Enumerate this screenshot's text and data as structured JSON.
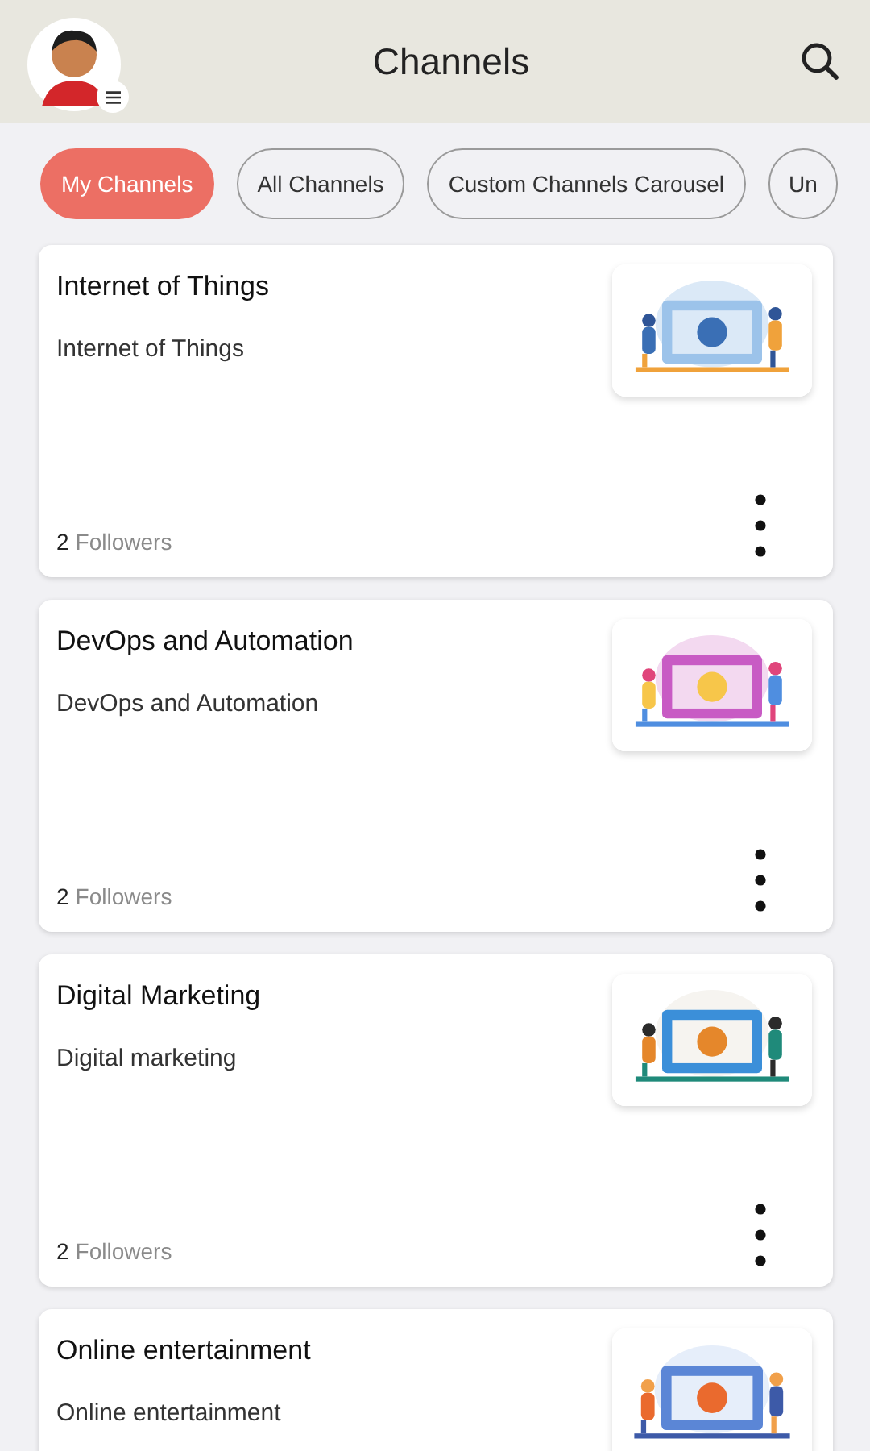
{
  "header": {
    "title": "Channels"
  },
  "filters": [
    {
      "label": "My Channels",
      "selected": true
    },
    {
      "label": "All Channels",
      "selected": false
    },
    {
      "label": "Custom Channels Carousel",
      "selected": false
    },
    {
      "label": "Un",
      "selected": false
    }
  ],
  "channels": [
    {
      "title": "Internet of Things",
      "description": "Internet of Things",
      "follower_count": "2",
      "follower_label": "Followers",
      "options_menu": true
    },
    {
      "title": "DevOps and Automation",
      "description": "DevOps and Automation",
      "follower_count": "2",
      "follower_label": "Followers",
      "options_menu": true
    },
    {
      "title": "Digital Marketing",
      "description": "Digital marketing",
      "follower_count": "2",
      "follower_label": "Followers",
      "options_menu": true
    },
    {
      "title": "Online entertainment",
      "description": "Online entertainment"
    }
  ]
}
